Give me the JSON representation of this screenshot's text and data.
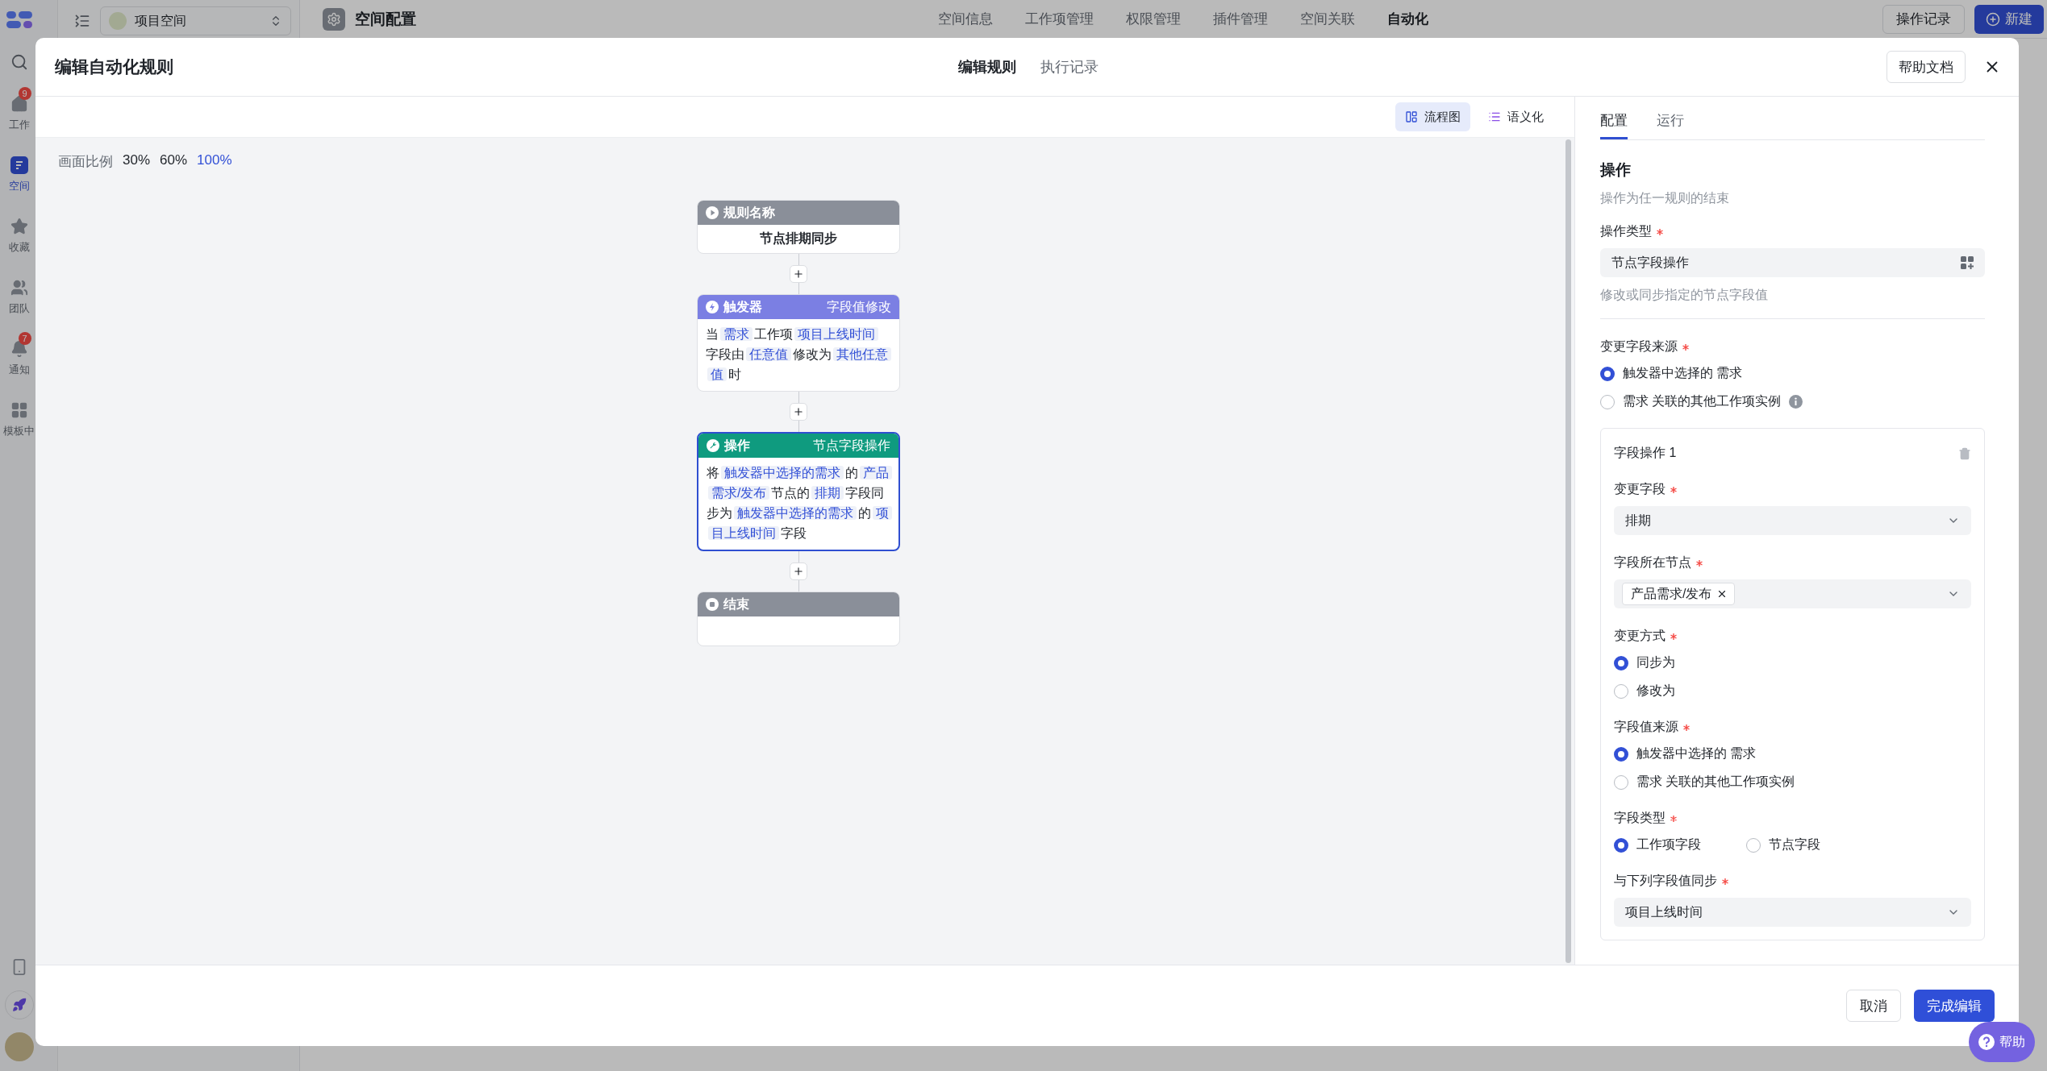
{
  "app_sidebar": {
    "items": [
      {
        "label": "工作",
        "badge": "9",
        "selected": false
      },
      {
        "label": "空间",
        "selected": true
      },
      {
        "label": "收藏",
        "selected": false
      },
      {
        "label": "团队",
        "selected": false
      },
      {
        "label": "通知",
        "badge": "7",
        "selected": false
      },
      {
        "label": "模板中",
        "selected": false
      }
    ]
  },
  "project_selector": {
    "label": "项目空间"
  },
  "top_bar": {
    "title": "空间配置",
    "tabs": [
      {
        "label": "空间信息",
        "selected": false
      },
      {
        "label": "工作项管理",
        "selected": false
      },
      {
        "label": "权限管理",
        "selected": false
      },
      {
        "label": "插件管理",
        "selected": false
      },
      {
        "label": "空间关联",
        "selected": false
      },
      {
        "label": "自动化",
        "selected": true
      }
    ],
    "history_button": "操作记录",
    "new_button": "新建"
  },
  "modal": {
    "title": "编辑自动化规则",
    "tabs": [
      {
        "label": "编辑规则",
        "selected": true
      },
      {
        "label": "执行记录",
        "selected": false
      }
    ],
    "help_button": "帮助文档",
    "view_modes": [
      {
        "label": "流程图",
        "kind": "flowchart",
        "selected": true
      },
      {
        "label": "语义化",
        "kind": "list",
        "selected": false
      }
    ],
    "zoom": {
      "label": "画面比例",
      "options": [
        {
          "label": "30%",
          "selected": false
        },
        {
          "label": "60%",
          "selected": false
        },
        {
          "label": "100%",
          "selected": true
        }
      ]
    },
    "nodes": [
      {
        "kind": "start",
        "title": "规则名称",
        "selected": false,
        "name": "节点排期同步"
      },
      {
        "kind": "trigger",
        "title": "触发器",
        "tag": "字段值修改",
        "selected": false,
        "segments": [
          {
            "text": "当",
            "token": false
          },
          {
            "text": "需求",
            "token": true
          },
          {
            "text": "工作项",
            "token": false
          },
          {
            "text": "项目上线时间",
            "token": true
          },
          {
            "text": "字段由",
            "token": false
          },
          {
            "text": "任意值",
            "token": true
          },
          {
            "text": "修改为",
            "token": false
          },
          {
            "text": "其他任意值",
            "token": true
          },
          {
            "text": "时",
            "token": false
          }
        ]
      },
      {
        "kind": "action",
        "title": "操作",
        "tag": "节点字段操作",
        "selected": true,
        "segments": [
          {
            "text": "将",
            "token": false
          },
          {
            "text": "触发器中选择的需求",
            "token": true
          },
          {
            "text": "的",
            "token": false
          },
          {
            "text": "产品需求/发布",
            "token": true
          },
          {
            "text": "节点的",
            "token": false
          },
          {
            "text": "排期",
            "token": true
          },
          {
            "text": "字段同步为",
            "token": false
          },
          {
            "text": "触发器中选择的需求",
            "token": true
          },
          {
            "text": "的",
            "token": false
          },
          {
            "text": "项目上线时间",
            "token": true
          },
          {
            "text": "字段",
            "token": false
          }
        ]
      },
      {
        "kind": "end",
        "title": "结束",
        "selected": false
      }
    ],
    "config": {
      "tabs": [
        {
          "label": "配置",
          "selected": true
        },
        {
          "label": "运行",
          "selected": false
        }
      ],
      "title": "操作",
      "description": "操作为任一规则的结束",
      "operation_type": {
        "label": "操作类型",
        "required": true,
        "value": "节点字段操作",
        "hint": "修改或同步指定的节点字段值"
      },
      "change_source": {
        "label": "变更字段来源",
        "required": true,
        "options": [
          {
            "label": "触发器中选择的 需求",
            "selected": true,
            "info": false
          },
          {
            "label": "需求 关联的其他工作项实例",
            "selected": false,
            "info": true
          }
        ]
      },
      "field_operation": {
        "title": "字段操作 1",
        "fields": [
          {
            "kind": "select",
            "label": "变更字段",
            "required": true,
            "value": "排期"
          },
          {
            "kind": "tags",
            "label": "字段所在节点",
            "required": true,
            "tags": [
              "产品需求/发布"
            ]
          },
          {
            "kind": "radio",
            "label": "变更方式",
            "required": true,
            "options": [
              {
                "label": "同步为",
                "selected": true
              },
              {
                "label": "修改为",
                "selected": false
              }
            ]
          },
          {
            "kind": "radio",
            "label": "字段值来源",
            "required": true,
            "options": [
              {
                "label": "触发器中选择的 需求",
                "selected": true
              },
              {
                "label": "需求 关联的其他工作项实例",
                "selected": false
              }
            ]
          },
          {
            "kind": "radio_row",
            "label": "字段类型",
            "required": true,
            "options": [
              {
                "label": "工作项字段",
                "selected": true
              },
              {
                "label": "节点字段",
                "selected": false
              }
            ]
          },
          {
            "kind": "select",
            "label": "与下列字段值同步",
            "required": true,
            "value": "项目上线时间"
          }
        ]
      }
    },
    "footer": {
      "cancel": "取消",
      "confirm": "完成编辑"
    }
  },
  "help_fab": {
    "label": "帮助"
  }
}
